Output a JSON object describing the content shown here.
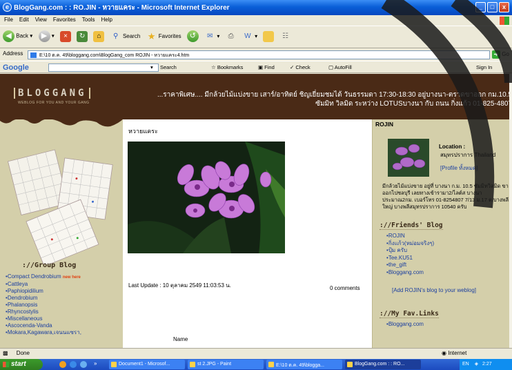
{
  "window": {
    "title": "BlogGang.com : : RO.JIN - หวายแคระ - Microsoft Internet Explorer"
  },
  "menu": [
    "File",
    "Edit",
    "View",
    "Favorites",
    "Tools",
    "Help"
  ],
  "toolbar": {
    "back": "Back",
    "search": "Search",
    "favorites": "Favorites"
  },
  "address": {
    "label": "Address",
    "value": "E:\\10 ต.ค. 49\\bloggang.com\\BlogGang_com  ROJIN - หวายแคระ4.htm",
    "go": "Go"
  },
  "googlebar": {
    "logo": "Google",
    "search": "Search",
    "bookmarks": "Bookmarks",
    "find": "Find",
    "check": "Check",
    "autofill": "AutoFill",
    "signin": "Sign In"
  },
  "header": {
    "logo": "BLOGGANG",
    "tagline": "WEBLOG FOR YOU AND YOUR GANG",
    "marquee_line1": "...ราคาพิเศษ.... มีกล้วยไม้แบ่งขาย เสาร์/อาทิตย์ ชิญเยี่ยมชมได้ วันธรรมดา 17:30-18:30 อยู่บางนา-ตราดขาออก กม.10.5",
    "marquee_line2": "ซัมมิท วิลมิด ระหว่าง LOTUSบางนา กับ ถนน กิ่งแก้ว 01-825-4807"
  },
  "left": {
    "group_title": "://Group Blog",
    "new_here": "new here",
    "groups": [
      "Compact Dendrobium",
      "Cattleya",
      "Paphiopidilium",
      "Dendrobium",
      "Phalanopsis",
      "Rhyncostylis",
      "Miscellaneous",
      "Ascocenda-Vanda",
      "Mokara,Kagawara,เจนนแซรา,"
    ]
  },
  "post": {
    "title": "หวายแคระ",
    "last_update": "Last Update : 10 ตุลาคม 2549 11:03:53 น.",
    "comments": "0 comments",
    "name_label": "Name"
  },
  "right": {
    "owner": "ROJIN",
    "location_label": "Location :",
    "location_value": "สมุทรปราการ Thailand",
    "profile_link": "[Profile ทั้งหมด]",
    "description": "มีกล้วยไม้แบ่งขาย อยู่ที่ บางนา ก.ม. 10.5 ซัมมิทวิลมิด ขาออกไปชลบุรี เลยทางเข้ารามา2/ไลต์ส บางนา ประมาณ2กม. เบอร์โทร 01-8254807 7/13 ม.17 ต.บางพลีใหญ่ บางพลีสมุทรปราการ 10540 ครับ",
    "friends_title": "://Friends' Blog",
    "friends": [
      "ROJIN",
      "กิ่งแก้ว(หม่อมจริงๆ)",
      "ปุ้ม ครับ",
      "Tee.KU51",
      "the_gift",
      "Bloggang.com"
    ],
    "add_link": "[Add ROJIN's blog to your weblog]",
    "fav_title": "://My Fav.Links",
    "fav_links": [
      "Bloggang.com"
    ]
  },
  "status": {
    "text": "Done",
    "zone": "Internet"
  },
  "taskbar": {
    "start": "start",
    "tasks": [
      "Document1 - Microsof...",
      "st 2.JPG - Paint",
      "E:\\10 ต.ค. 49\\blogga...",
      "BlogGang.com : : RO..."
    ],
    "lang": "EN",
    "clock": "2:27"
  },
  "colors": {
    "header_bg": "#4a2a16",
    "sidebar_bg": "#d4cfaa",
    "link": "#1a3ea0",
    "titlebar": "#0a5fd8",
    "start": "#3c9a2c"
  }
}
